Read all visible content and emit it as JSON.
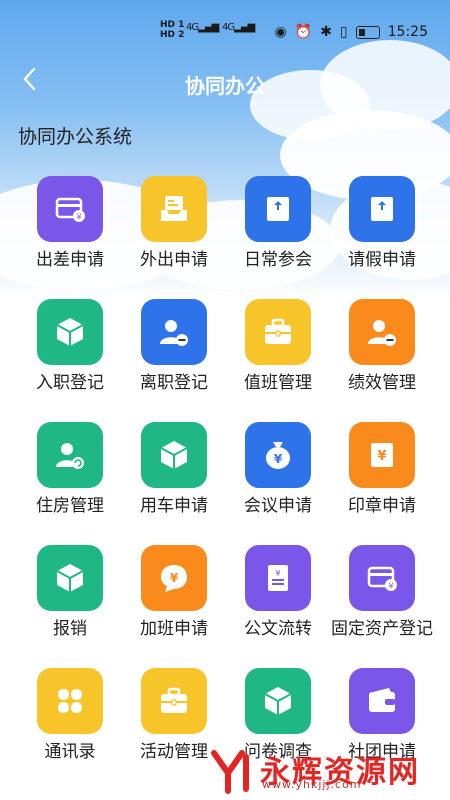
{
  "status_bar": {
    "time": "15:25",
    "left_badges": [
      "HD 1",
      "HD 2"
    ],
    "net": "4G"
  },
  "header": {
    "title": "协同办公"
  },
  "section": {
    "title": "协同办公系统"
  },
  "colors": {
    "purple": "#7a57e8",
    "yellow": "#f7c42a",
    "blue": "#2f73ea",
    "green": "#1fb885",
    "orange": "#fb8a1c"
  },
  "apps": [
    {
      "label": "出差申请",
      "color": "purple",
      "icon": "card-yen-icon"
    },
    {
      "label": "外出申请",
      "color": "yellow",
      "icon": "inbox-icon"
    },
    {
      "label": "日常参会",
      "color": "blue",
      "icon": "upload-box-icon"
    },
    {
      "label": "请假申请",
      "color": "blue",
      "icon": "upload-box-icon"
    },
    {
      "label": "入职登记",
      "color": "green",
      "icon": "cube-icon"
    },
    {
      "label": "离职登记",
      "color": "blue",
      "icon": "user-minus-icon"
    },
    {
      "label": "值班管理",
      "color": "yellow",
      "icon": "briefcase-icon"
    },
    {
      "label": "绩效管理",
      "color": "orange",
      "icon": "user-minus-icon"
    },
    {
      "label": "住房管理",
      "color": "green",
      "icon": "user-refresh-icon"
    },
    {
      "label": "用车申请",
      "color": "green",
      "icon": "cube-icon"
    },
    {
      "label": "会议申请",
      "color": "blue",
      "icon": "money-bag-icon"
    },
    {
      "label": "印章申请",
      "color": "orange",
      "icon": "yen-box-icon"
    },
    {
      "label": "报销",
      "color": "green",
      "icon": "cube-icon"
    },
    {
      "label": "加班申请",
      "color": "orange",
      "icon": "yen-bubble-icon"
    },
    {
      "label": "公文流转",
      "color": "purple",
      "icon": "document-yen-icon"
    },
    {
      "label": "固定资产登记",
      "color": "purple",
      "icon": "card-yen-icon"
    },
    {
      "label": "通讯录",
      "color": "yellow",
      "icon": "four-petal-icon"
    },
    {
      "label": "活动管理",
      "color": "yellow",
      "icon": "briefcase-icon"
    },
    {
      "label": "问卷调查",
      "color": "green",
      "icon": "cube-icon"
    },
    {
      "label": "社团申请",
      "color": "purple",
      "icon": "wallet-icon"
    }
  ],
  "watermark": {
    "text": "永辉资源网",
    "url": "www.yhkjjj.com"
  }
}
